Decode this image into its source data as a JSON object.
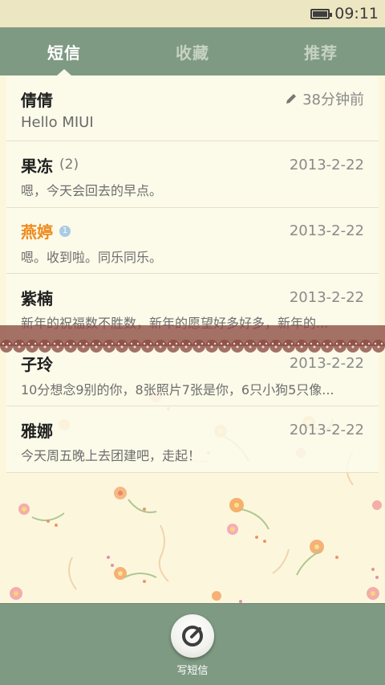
{
  "status_bar": {
    "time": "09:11",
    "battery_icon": "battery-icon"
  },
  "tabs": [
    {
      "label": "短信",
      "active": true
    },
    {
      "label": "收藏",
      "active": false
    },
    {
      "label": "推荐",
      "active": false
    }
  ],
  "conversations": [
    {
      "name": "倩倩",
      "count": "",
      "time": "38分钟前",
      "preview": "Hello MIUI",
      "draft": true
    },
    {
      "name": "果冻",
      "count": "(2)",
      "time": "2013-2-22",
      "preview": "嗯，今天会回去的早点。"
    },
    {
      "name": "燕婷",
      "count": "",
      "time": "2013-2-22",
      "preview": "嗯。收到啦。同乐同乐。",
      "unread_badge": "1",
      "highlight_color": "#ee8a1d"
    },
    {
      "name": "紫楠",
      "count": "",
      "time": "2013-2-22",
      "preview": "新年的祝福数不胜数，新年的愿望好多好多，新年的..."
    },
    {
      "name": "子玲",
      "count": "",
      "time": "2013-2-22",
      "preview": "10分想念9别的你，8张照片7张是你，6只小狗5只像..."
    },
    {
      "name": "雅娜",
      "count": "",
      "time": "2013-2-22",
      "preview": "今天周五晚上去团建吧，走起！"
    }
  ],
  "compose": {
    "label": "写短信"
  },
  "colors": {
    "accent": "#7f9a83",
    "status_bar": "#ece6c2",
    "lace": "#8a4a42"
  }
}
